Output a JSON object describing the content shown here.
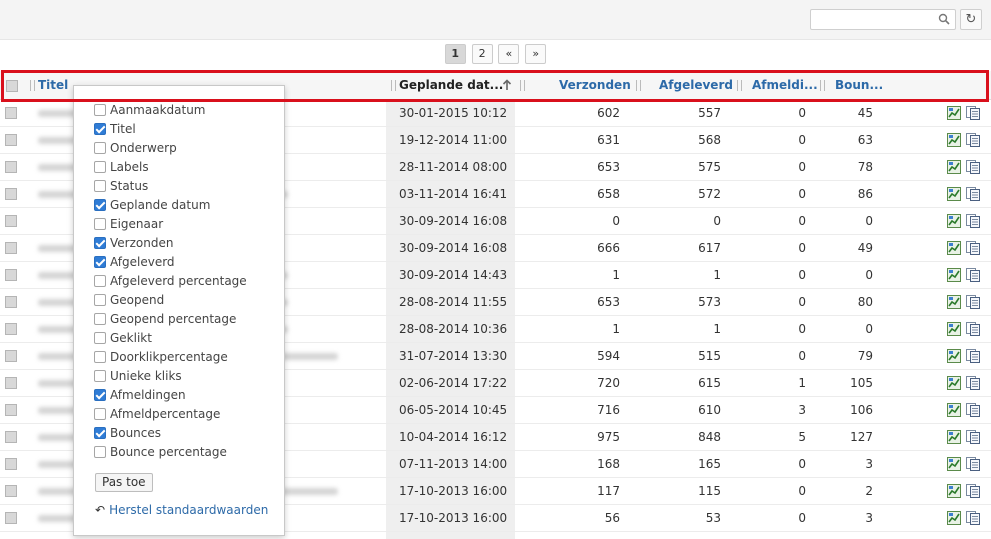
{
  "search": {
    "placeholder": "",
    "value": ""
  },
  "toolbar": {
    "refresh_icon": "refresh-icon",
    "search_icon": "search-icon"
  },
  "pagination": {
    "pages": [
      "1",
      "2"
    ],
    "current": "1",
    "prev": "«",
    "next": "»"
  },
  "columns": {
    "title": "Titel",
    "scheduled": "Geplande dat...",
    "sent": "Verzonden",
    "delivered": "Afgeleverd",
    "unsubscribed": "Afmeldi...",
    "bounces": "Boun...",
    "sort_icon": "arrow-up-icon"
  },
  "colors": {
    "link": "#2d6aa8",
    "highlight": "#d9101c",
    "checked": "#2f7cd6"
  },
  "rows": [
    {
      "date": "30-01-2015 10:12",
      "sent": "602",
      "delivered": "557",
      "unsub": "0",
      "bounces": "45"
    },
    {
      "date": "19-12-2014 11:00",
      "sent": "631",
      "delivered": "568",
      "unsub": "0",
      "bounces": "63"
    },
    {
      "date": "28-11-2014 08:00",
      "sent": "653",
      "delivered": "575",
      "unsub": "0",
      "bounces": "78"
    },
    {
      "date": "03-11-2014 16:41",
      "sent": "658",
      "delivered": "572",
      "unsub": "0",
      "bounces": "86"
    },
    {
      "date": "30-09-2014 16:08",
      "sent": "0",
      "delivered": "0",
      "unsub": "0",
      "bounces": "0"
    },
    {
      "date": "30-09-2014 16:08",
      "sent": "666",
      "delivered": "617",
      "unsub": "0",
      "bounces": "49"
    },
    {
      "date": "30-09-2014 14:43",
      "sent": "1",
      "delivered": "1",
      "unsub": "0",
      "bounces": "0"
    },
    {
      "date": "28-08-2014 11:55",
      "sent": "653",
      "delivered": "573",
      "unsub": "0",
      "bounces": "80"
    },
    {
      "date": "28-08-2014 10:36",
      "sent": "1",
      "delivered": "1",
      "unsub": "0",
      "bounces": "0"
    },
    {
      "date": "31-07-2014 13:30",
      "sent": "594",
      "delivered": "515",
      "unsub": "0",
      "bounces": "79"
    },
    {
      "date": "02-06-2014 17:22",
      "sent": "720",
      "delivered": "615",
      "unsub": "1",
      "bounces": "105"
    },
    {
      "date": "06-05-2014 10:45",
      "sent": "716",
      "delivered": "610",
      "unsub": "3",
      "bounces": "106"
    },
    {
      "date": "10-04-2014 16:12",
      "sent": "975",
      "delivered": "848",
      "unsub": "5",
      "bounces": "127"
    },
    {
      "date": "07-11-2013 14:00",
      "sent": "168",
      "delivered": "165",
      "unsub": "0",
      "bounces": "3"
    },
    {
      "date": "17-10-2013 16:00",
      "sent": "117",
      "delivered": "115",
      "unsub": "0",
      "bounces": "2"
    },
    {
      "date": "17-10-2013 16:00",
      "sent": "56",
      "delivered": "53",
      "unsub": "0",
      "bounces": "3"
    }
  ],
  "row_icons": [
    "stats-chart-icon",
    "copy-document-icon"
  ],
  "column_menu": {
    "items": [
      {
        "label": "Aanmaakdatum",
        "checked": false
      },
      {
        "label": "Titel",
        "checked": true
      },
      {
        "label": "Onderwerp",
        "checked": false
      },
      {
        "label": "Labels",
        "checked": false
      },
      {
        "label": "Status",
        "checked": false
      },
      {
        "label": "Geplande datum",
        "checked": true
      },
      {
        "label": "Eigenaar",
        "checked": false
      },
      {
        "label": "Verzonden",
        "checked": true
      },
      {
        "label": "Afgeleverd",
        "checked": true
      },
      {
        "label": "Afgeleverd percentage",
        "checked": false
      },
      {
        "label": "Geopend",
        "checked": false
      },
      {
        "label": "Geopend percentage",
        "checked": false
      },
      {
        "label": "Geklikt",
        "checked": false
      },
      {
        "label": "Doorklikpercentage",
        "checked": false
      },
      {
        "label": "Unieke kliks",
        "checked": false
      },
      {
        "label": "Afmeldingen",
        "checked": true
      },
      {
        "label": "Afmeldpercentage",
        "checked": false
      },
      {
        "label": "Bounces",
        "checked": true
      },
      {
        "label": "Bounce percentage",
        "checked": false
      }
    ],
    "apply_label": "Pas toe",
    "reset_label": "Herstel standaardwaarden",
    "reset_icon": "undo-arrow-icon"
  }
}
